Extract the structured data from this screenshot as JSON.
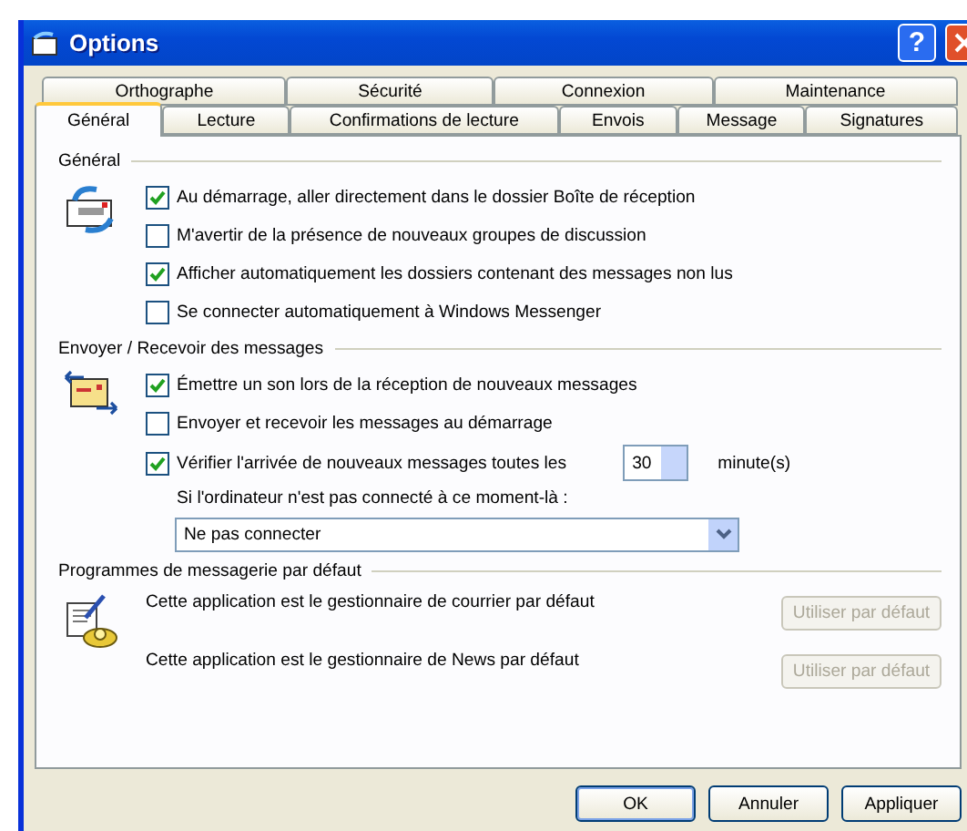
{
  "window": {
    "title": "Options",
    "help_button": "?"
  },
  "tabs": [
    [
      {
        "label": "Orthographe",
        "selected": false
      },
      {
        "label": "Sécurité",
        "selected": false
      },
      {
        "label": "Connexion",
        "selected": false
      },
      {
        "label": "Maintenance",
        "selected": false
      }
    ],
    [
      {
        "label": "Général",
        "selected": true
      },
      {
        "label": "Lecture",
        "selected": false
      },
      {
        "label": "Confirmations de lecture",
        "selected": false
      },
      {
        "label": "Envois",
        "selected": false
      },
      {
        "label": "Message",
        "selected": false
      },
      {
        "label": "Signatures",
        "selected": false
      }
    ]
  ],
  "sections": [
    {
      "title": "Général",
      "items": [
        {
          "kind": "checkbox",
          "label": "Au démarrage, aller directement dans le dossier Boîte de réception",
          "checked": true
        },
        {
          "kind": "checkbox",
          "label": "M'avertir de la présence de nouveaux groupes de discussion",
          "checked": false
        },
        {
          "kind": "checkbox",
          "label": "Afficher automatiquement les dossiers contenant des messages non lus",
          "checked": true
        },
        {
          "kind": "checkbox",
          "label": "Se connecter automatiquement à Windows Messenger",
          "checked": false
        }
      ]
    },
    {
      "title": "Envoyer / Recevoir des messages",
      "items": [
        {
          "kind": "checkbox",
          "label": "Émettre un son lors de la réception de nouveaux messages",
          "checked": true
        },
        {
          "kind": "checkbox",
          "label": "Envoyer et recevoir les messages au démarrage",
          "checked": false
        },
        {
          "kind": "spin",
          "label": "Vérifier l'arrivée de nouveaux messages toutes les",
          "checked": true,
          "value": "30",
          "unit": "minute(s)"
        },
        {
          "kind": "note",
          "label": "Si l'ordinateur n'est pas connecté à ce moment-là :"
        },
        {
          "kind": "dropdown",
          "value": "Ne pas connecter"
        }
      ]
    },
    {
      "title": "Programmes de messagerie par défaut",
      "items": [
        {
          "kind": "default",
          "label": "Cette application est le gestionnaire de courrier par défaut",
          "button": "Utiliser par défaut",
          "disabled": true
        },
        {
          "kind": "default",
          "label": "Cette application est le gestionnaire de News par défaut",
          "button": "Utiliser par défaut",
          "disabled": true
        }
      ]
    }
  ],
  "buttons": [
    {
      "label": "OK",
      "default": true
    },
    {
      "label": "Annuler",
      "default": false
    },
    {
      "label": "Appliquer",
      "default": false
    }
  ]
}
